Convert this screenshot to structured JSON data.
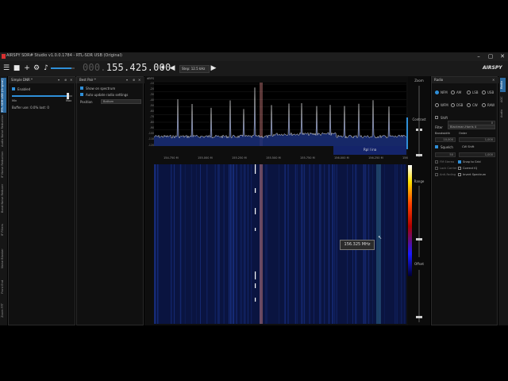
{
  "window": {
    "title": "AIRSPY SDR# Studio v1.0.0.1784 - RTL-SDR USB (Original)",
    "buttons": [
      "–",
      "▢",
      "✕"
    ]
  },
  "toolbar": {
    "frequency_dim": "000.",
    "frequency_main": "155.425.000",
    "step_label": "Step: 12.5 kHz",
    "logo": "AIRSPY",
    "volume_fraction": 0.85,
    "icons": [
      "hamburger-icon",
      "stop-icon",
      "add-icon",
      "gear-icon",
      "speaker-icon",
      "pin-icon",
      "left-icon",
      "right-icon"
    ]
  },
  "left_tabs": [
    "RTL-SDR USB (Original)",
    "Audio Noise Reduction",
    "IF Noise Reduction",
    "Band Noise Reducer",
    "IF Filters",
    "Noise Blanker",
    "Front End",
    "Zoom FFT"
  ],
  "simple_dnr": {
    "title": "Simple DNR *",
    "enabled_label": "Enabled",
    "enabled": true,
    "min_label": "Min",
    "max_label": "Max",
    "buffer_text": "Buffer use: 0.0% lost: 0"
  },
  "best_pair": {
    "title": "Best Pair *",
    "show_on_spectrum": "Show on spectrum",
    "auto_update": "Auto update radio settings",
    "position_label": "Position",
    "position_value": "Bottom"
  },
  "spectrum": {
    "unit_label": "dBFS",
    "y_ticks": [
      "-10",
      "-20",
      "-30",
      "-40",
      "-50",
      "-60",
      "-70",
      "-80",
      "-90",
      "-100",
      "-110",
      "-120"
    ],
    "band_label": "Rpl l ina",
    "freq_ticks": [
      "154.750 M",
      "155.000 M",
      "155.250 M",
      "155.500 M",
      "155.750 M",
      "156.000 M",
      "156.250 M",
      "156.500 M"
    ]
  },
  "waterfall": {
    "tooltip": "156.325 MHz"
  },
  "controls": {
    "zoom": "Zoom",
    "contrast": "Contrast",
    "range": "Range",
    "offset": "Offset"
  },
  "radio": {
    "title": "Radio",
    "modes": [
      {
        "label": "NFM",
        "on": true
      },
      {
        "label": "AM",
        "on": false
      },
      {
        "label": "LSB",
        "on": false
      },
      {
        "label": "USB",
        "on": false
      },
      {
        "label": "WFM",
        "on": false
      },
      {
        "label": "DSB",
        "on": false
      },
      {
        "label": "CW",
        "on": false
      },
      {
        "label": "RAW",
        "on": false
      }
    ],
    "shift_label": "Shift",
    "shift_value": "0",
    "filter_label": "Filter",
    "filter_value": "Blackman-Harris 4",
    "bandwidth_label": "Bandwidth",
    "bandwidth_value": "10,000",
    "order_label": "Order",
    "order_value": "1,000",
    "squelch_label": "Squelch",
    "cw_shift_label": "CW Shift",
    "squelch_value": "50",
    "cw_shift_value": "1,000",
    "fm_stereo": "FM Stereo",
    "snap_to_grid": "Snap to Grid",
    "lock_carrier": "Lock Carrier",
    "correct_iq": "Correct IQ",
    "anti_fading": "Anti-Fading",
    "swap_iq": "Invert Spectrum"
  },
  "right_tabs": [
    "Radio",
    "AGC",
    "Audio"
  ]
}
